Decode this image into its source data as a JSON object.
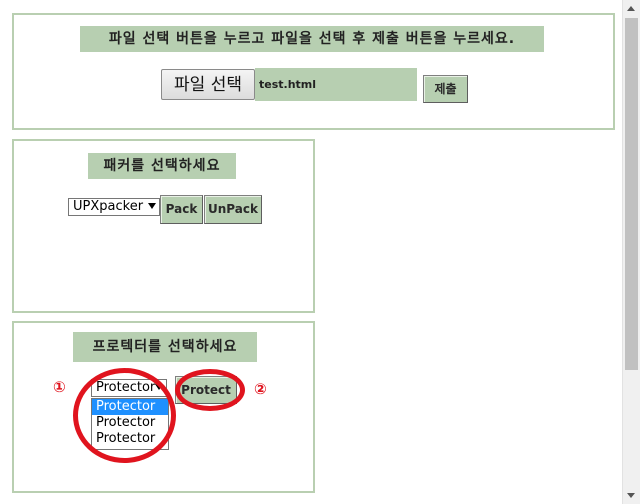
{
  "upload_panel": {
    "heading": "파일 선택 버튼을 누르고 파일을 선택 후 제출 버튼을 누르세요.",
    "file_button_label": "파일 선택",
    "file_name": "test.html",
    "submit_label": "제출"
  },
  "packer_panel": {
    "heading": "패커를 선택하세요",
    "select_value": "UPXpacker",
    "pack_label": "Pack",
    "unpack_label": "UnPack"
  },
  "protector_panel": {
    "heading": "프로텍터를 선택하세요",
    "select_value": "Protector",
    "options": [
      "Protector",
      "Protector",
      "Protector"
    ],
    "protect_label": "Protect"
  },
  "annotations": {
    "marker_1": "①",
    "marker_2": "②"
  },
  "colors": {
    "panel_border": "#b9cfb1",
    "heading_bg": "#b7cfb1",
    "annotation_red": "#e0141e",
    "selected_option": "#1e90ff"
  }
}
